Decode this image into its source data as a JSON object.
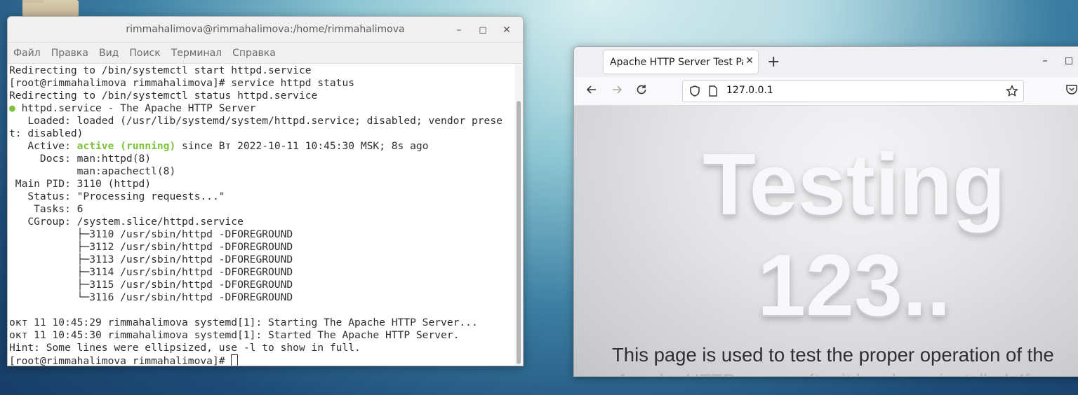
{
  "terminal": {
    "title": "rimmahalimova@rimmahalimova:/home/rimmahalimova",
    "controls": [
      "–",
      "◻",
      "✕"
    ],
    "menu": [
      "Файл",
      "Правка",
      "Вид",
      "Поиск",
      "Терминал",
      "Справка"
    ],
    "lines": [
      {
        "text": "Redirecting to /bin/systemctl start httpd.service"
      },
      {
        "text": "[root@rimmahalimova rimmahalimova]# service httpd status"
      },
      {
        "text": "Redirecting to /bin/systemctl status httpd.service"
      },
      {
        "dot": "●",
        "text": " httpd.service - The Apache HTTP Server"
      },
      {
        "text": "   Loaded: loaded (/usr/lib/systemd/system/httpd.service; disabled; vendor prese"
      },
      {
        "text": "t: disabled)"
      },
      {
        "pre": "   Active: ",
        "green": "active (running)",
        "post": " since Вт 2022-10-11 10:45:30 MSK; 8s ago"
      },
      {
        "text": "     Docs: man:httpd(8)"
      },
      {
        "text": "           man:apachectl(8)"
      },
      {
        "text": " Main PID: 3110 (httpd)"
      },
      {
        "text": "   Status: \"Processing requests...\""
      },
      {
        "text": "    Tasks: 6"
      },
      {
        "text": "   CGroup: /system.slice/httpd.service"
      },
      {
        "text": "           ├─3110 /usr/sbin/httpd -DFOREGROUND"
      },
      {
        "text": "           ├─3112 /usr/sbin/httpd -DFOREGROUND"
      },
      {
        "text": "           ├─3113 /usr/sbin/httpd -DFOREGROUND"
      },
      {
        "text": "           ├─3114 /usr/sbin/httpd -DFOREGROUND"
      },
      {
        "text": "           ├─3115 /usr/sbin/httpd -DFOREGROUND"
      },
      {
        "text": "           └─3116 /usr/sbin/httpd -DFOREGROUND"
      },
      {
        "text": ""
      },
      {
        "text": "окт 11 10:45:29 rimmahalimova systemd[1]: Starting The Apache HTTP Server..."
      },
      {
        "text": "окт 11 10:45:30 rimmahalimova systemd[1]: Started The Apache HTTP Server."
      },
      {
        "text": "Hint: Some lines were ellipsized, use -l to show in full."
      },
      {
        "text": "[root@rimmahalimova rimmahalimova]# ",
        "cursor": true
      }
    ]
  },
  "browser": {
    "tab_title": "Apache HTTP Server Test Page",
    "tab_close": "✕",
    "new_tab": "+",
    "controls": [
      "–",
      "◻"
    ],
    "url": "127.0.0.1",
    "page": {
      "heading_line1": "Testing",
      "heading_line2": "123..",
      "description": "This page is used to test the proper operation of the",
      "description_cut": "Apache HTTP server after it has been installed. If"
    }
  },
  "icons": [
    "close-icon",
    "back-arrow-icon",
    "forward-arrow-icon",
    "reload-icon",
    "shield-icon",
    "page-icon",
    "star-icon",
    "pocket-icon",
    "folder-icon"
  ]
}
